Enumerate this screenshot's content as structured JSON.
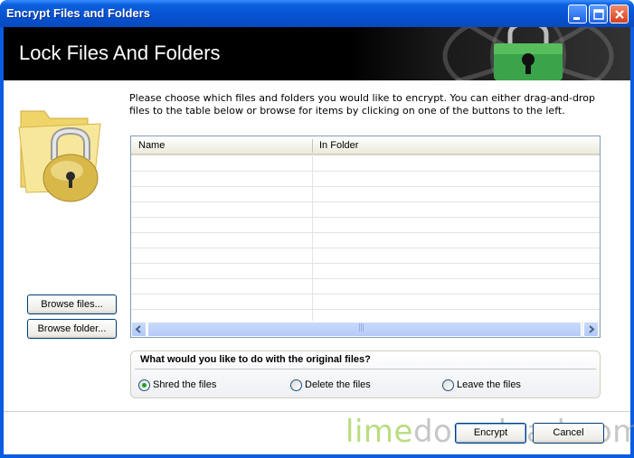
{
  "window": {
    "title": "Encrypt Files and Folders"
  },
  "header": {
    "title": "Lock Files And Folders"
  },
  "instructions": "Please choose which files and folders you would like to encrypt. You can either drag-and-drop files to the table below or browse for items by clicking on one of the buttons to the left.",
  "browse": {
    "files_label": "Browse files...",
    "folder_label": "Browse folder..."
  },
  "table": {
    "columns": [
      "Name",
      "In Folder"
    ],
    "rows": [],
    "scroll_grip": "|||"
  },
  "options": {
    "question": "What would you like to do with the original files?",
    "choices": [
      {
        "label": "Shred the files",
        "selected": true
      },
      {
        "label": "Delete the files",
        "selected": false
      },
      {
        "label": "Leave the files",
        "selected": false
      }
    ]
  },
  "watermark": {
    "part1": "lime",
    "part2": "download.com"
  },
  "buttons": {
    "encrypt": "Encrypt",
    "cancel": "Cancel"
  },
  "colors": {
    "titlebar": "#0752d0",
    "header_bg": "#000000",
    "accent_green": "#21a121"
  }
}
